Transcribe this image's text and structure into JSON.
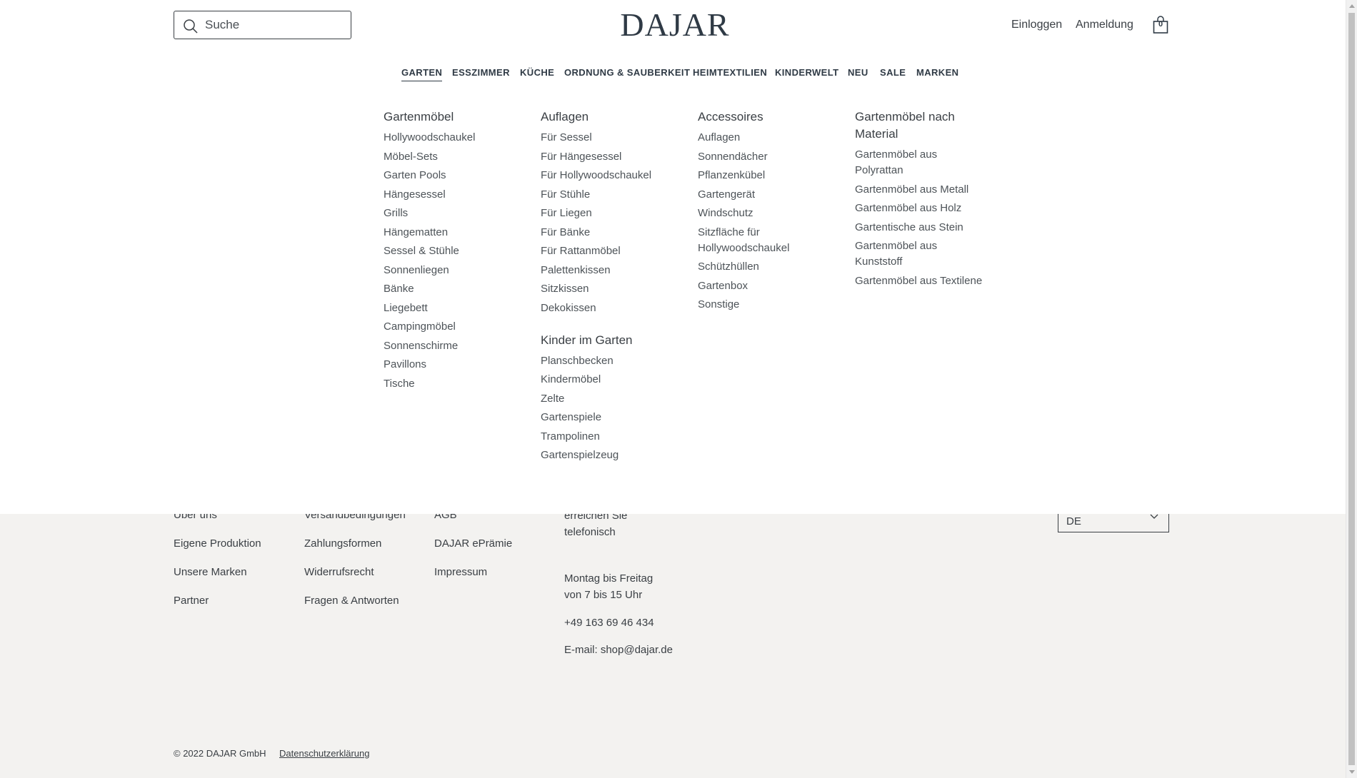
{
  "header": {
    "search_placeholder": "Suche",
    "logo": "DAJAR",
    "login": "Einloggen",
    "register": "Anmeldung",
    "cart_count": "0"
  },
  "nav": [
    "GARTEN",
    "ESSZIMMER",
    "KÜCHE",
    "ORDNUNG & SAUBERKEIT",
    "HEIMTEXTILIEN",
    "KINDERWELT",
    "NEU",
    "SALE",
    "MARKEN"
  ],
  "menu": {
    "col1": {
      "title": "Gartenmöbel",
      "items": [
        "Hollywoodschaukel",
        "Möbel-Sets",
        "Garten Pools",
        "Hängesessel",
        "Grills",
        "Hängematten",
        "Sessel & Stühle",
        "Sonnenliegen",
        "Bänke",
        "Liegebett",
        "Campingmöbel",
        "Sonnenschirme",
        "Pavillons",
        "Tische"
      ]
    },
    "col2": {
      "title": "Auflagen",
      "items": [
        "Für Sessel",
        "Für Hängesessel",
        "Für Hollywoodschaukel",
        "Für Stühle",
        "Für Liegen",
        "Für Bänke",
        "Für Rattanmöbel",
        "Palettenkissen",
        "Sitzkissen",
        "Dekokissen"
      ],
      "title2": "Kinder im Garten",
      "items2": [
        "Planschbecken",
        "Kindermöbel",
        "Zelte",
        "Gartenspiele",
        "Trampolinen",
        "Gartenspielzeug"
      ]
    },
    "col3": {
      "title": "Accessoires",
      "items": [
        "Auflagen",
        "Sonnendächer",
        "Pflanzenkübel",
        "Gartengerät",
        "Windschutz",
        "Sitzfläche für Hollywoodschaukel",
        "Schützhüllen",
        "Gartenbox",
        "Sonstige"
      ]
    },
    "col4": {
      "title": "Gartenmöbel nach Material",
      "items": [
        "Gartenmöbel aus Polyrattan",
        "Gartenmöbel aus Metall",
        "Gartenmöbel aus Holz",
        "Gartentische aus Stein",
        "Gartenmöbel aus Kunststoff",
        "Gartenmöbel aus Textilene"
      ]
    }
  },
  "footer": {
    "col1": [
      "Über uns",
      "Eigene Produktion",
      "Unsere Marken",
      "Partner"
    ],
    "col2": [
      "Versandbedingungen",
      "Zahlungsformen",
      "Widerrufsrecht",
      "Fragen & Antworten"
    ],
    "col3": [
      "AGB",
      "DAJAR ePrämie",
      "Impressum"
    ],
    "contact_intro": "Unseren Kundenservice erreichen Sie telefonisch",
    "contact_hours": "Montag bis Freitag von 7 bis 15 Uhr",
    "phone": "+49 163 69 46 434",
    "email": "E-mail: shop@dajar.de",
    "language": "DE",
    "copyright": "© 2022 DAJAR GmbH",
    "privacy": "Datenschutzerklärung"
  }
}
